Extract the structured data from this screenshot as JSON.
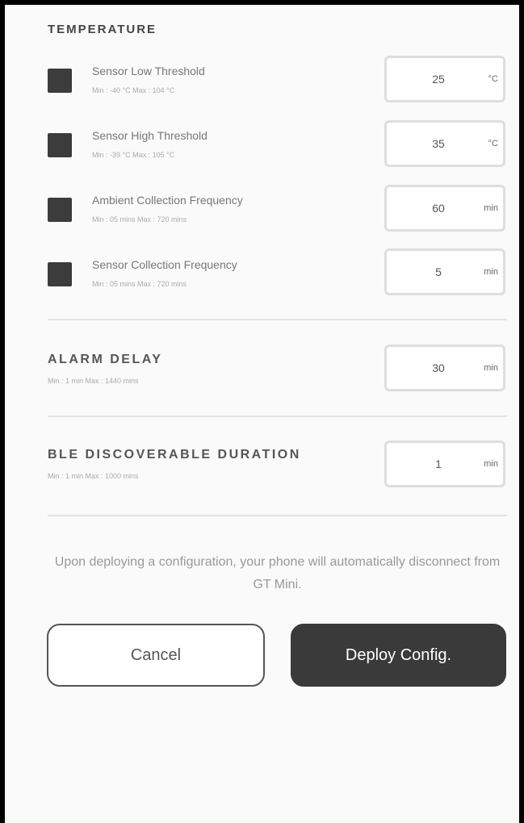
{
  "temperature": {
    "title": "TEMPERATURE",
    "rows": [
      {
        "label": "Sensor Low Threshold",
        "range": "Min : -40 °C    Max : 104 °C",
        "value": "25",
        "unit": "°C"
      },
      {
        "label": "Sensor High Threshold",
        "range": "Min : -39 °C    Max : 105 °C",
        "value": "35",
        "unit": "°C"
      },
      {
        "label": "Ambient Collection Frequency",
        "range": "Min : 05 mins    Max : 720 mins",
        "value": "60",
        "unit": "min"
      },
      {
        "label": "Sensor Collection Frequency",
        "range": "Min : 05 mins    Max : 720 mins",
        "value": "5",
        "unit": "min"
      }
    ]
  },
  "alarm_delay": {
    "label": "ALARM DELAY",
    "range": "Min : 1 min    Max : 1440 mins",
    "value": "30",
    "unit": "min"
  },
  "ble_duration": {
    "label": "BLE DISCOVERABLE DURATION",
    "range": "Min : 1 min    Max : 1000 mins",
    "value": "1",
    "unit": "min"
  },
  "notice": "Upon deploying a configuration, your phone will automatically disconnect from GT Mini.",
  "buttons": {
    "cancel": "Cancel",
    "deploy": "Deploy Config."
  }
}
